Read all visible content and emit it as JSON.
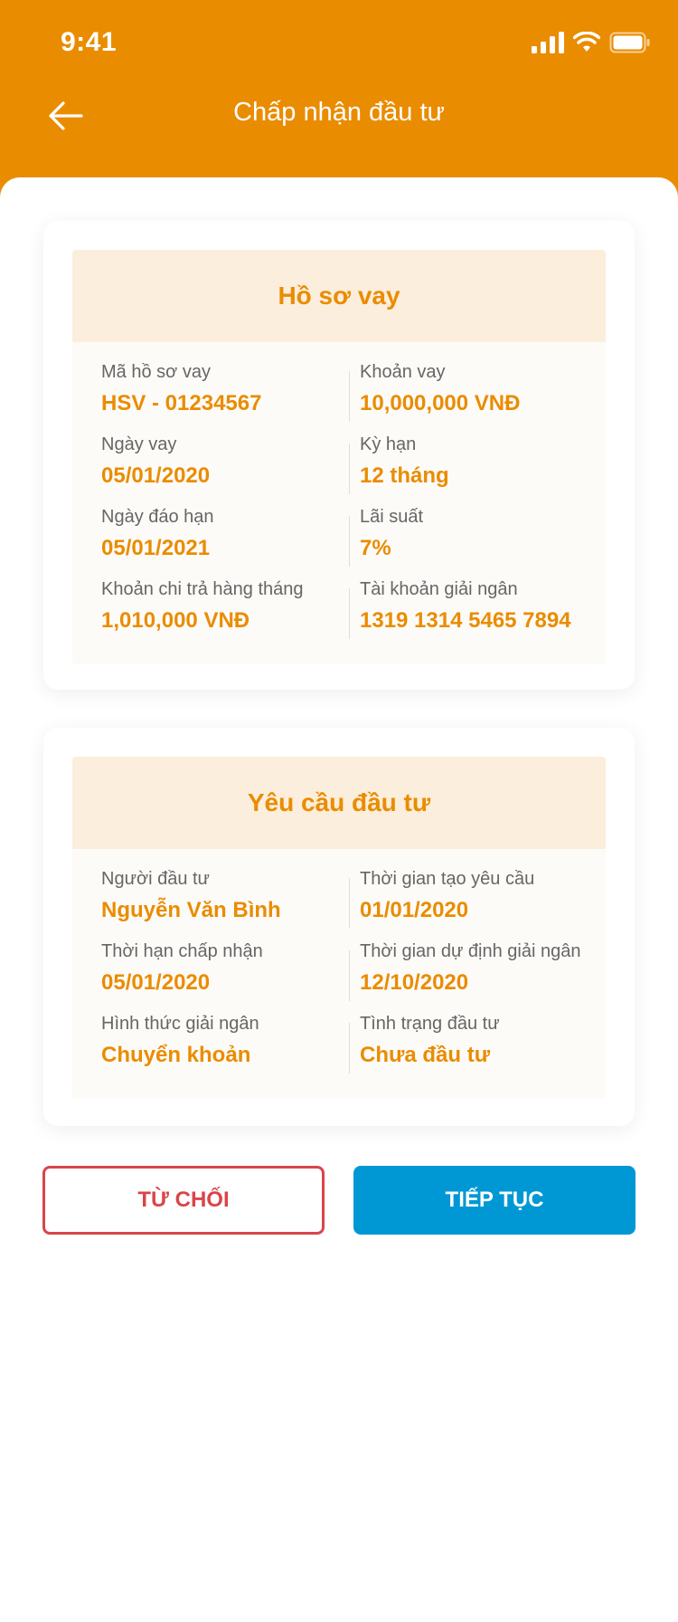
{
  "status_bar": {
    "time": "9:41"
  },
  "header": {
    "title": "Chấp nhận đầu tư"
  },
  "loan_card": {
    "title": "Hồ sơ vay",
    "rows": [
      {
        "left_label": "Mã hồ sơ vay",
        "left_value": "HSV - 01234567",
        "right_label": "Khoản vay",
        "right_value": "10,000,000 VNĐ"
      },
      {
        "left_label": "Ngày vay",
        "left_value": "05/01/2020",
        "right_label": "Kỳ hạn",
        "right_value": "12 tháng"
      },
      {
        "left_label": "Ngày đáo hạn",
        "left_value": "05/01/2021",
        "right_label": "Lãi suất",
        "right_value": "7%"
      },
      {
        "left_label": "Khoản chi trả hàng tháng",
        "left_value": "1,010,000 VNĐ",
        "right_label": "Tài khoản giải ngân",
        "right_value": "1319 1314 5465 7894"
      }
    ]
  },
  "invest_card": {
    "title": "Yêu cầu đầu tư",
    "rows": [
      {
        "left_label": "Người đầu tư",
        "left_value": "Nguyễn Văn Bình",
        "right_label": "Thời gian tạo yêu cầu",
        "right_value": "01/01/2020"
      },
      {
        "left_label": "Thời hạn chấp nhận",
        "left_value": "05/01/2020",
        "right_label": "Thời gian dự định giải ngân",
        "right_value": "12/10/2020"
      },
      {
        "left_label": "Hình thức giải ngân",
        "left_value": "Chuyển khoản",
        "right_label": "Tình trạng đầu tư",
        "right_value": "Chưa đầu tư"
      }
    ]
  },
  "actions": {
    "reject_label": "TỪ CHỐI",
    "continue_label": "TIẾP TỤC"
  },
  "colors": {
    "accent": "#EA8C00",
    "primary_button": "#0098D4",
    "reject": "#D9454A"
  }
}
